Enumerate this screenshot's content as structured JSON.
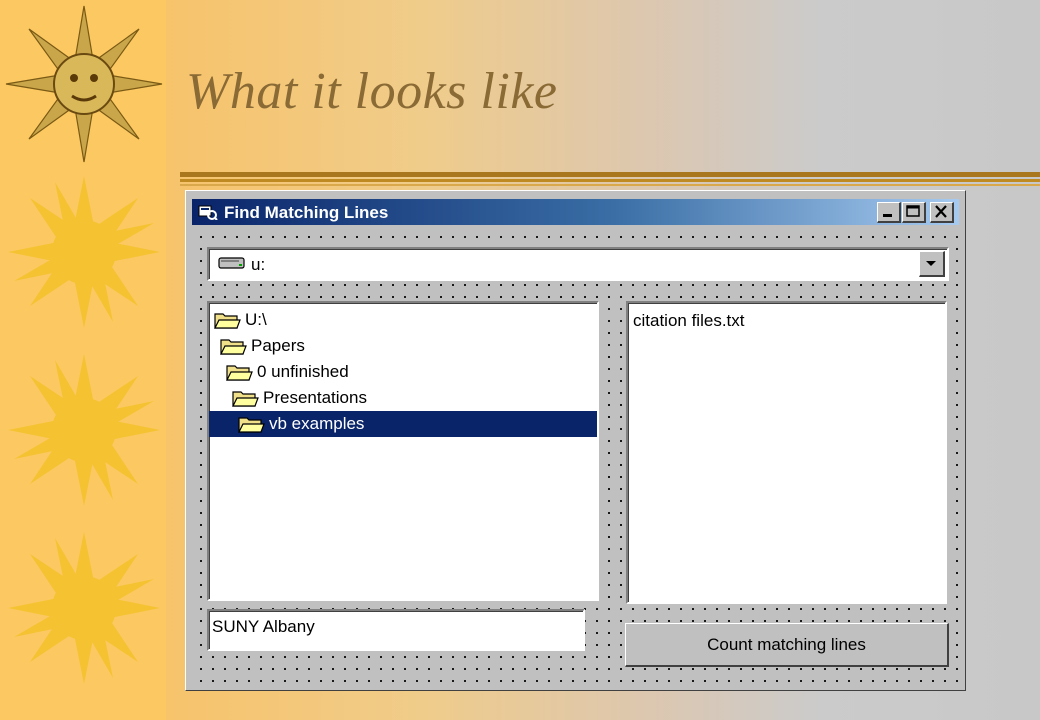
{
  "slide": {
    "title": "What it looks like"
  },
  "window": {
    "title": "Find Matching Lines",
    "controls": [
      "minimize-icon",
      "maximize-icon",
      "close-icon"
    ]
  },
  "drive_combo": {
    "value": "u:",
    "icon": "drive-icon"
  },
  "dir_list": {
    "items": [
      {
        "label": "U:\\",
        "selected": false
      },
      {
        "label": "Papers",
        "selected": false
      },
      {
        "label": "0 unfinished",
        "selected": false
      },
      {
        "label": "Presentations",
        "selected": false
      },
      {
        "label": "vb examples",
        "selected": true
      }
    ],
    "icon": "folder-icon"
  },
  "file_list": {
    "items": [
      "citation files.txt"
    ]
  },
  "search_text": {
    "value": "SUNY Albany"
  },
  "count_button": {
    "label": "Count matching lines"
  },
  "colors": {
    "titlebar_start": "#0a246a",
    "titlebar_end": "#a6caf0",
    "selection": "#0a246a",
    "sidebar": "#fcc862",
    "title_text": "#8a6a35",
    "sun": "#f5c332"
  }
}
